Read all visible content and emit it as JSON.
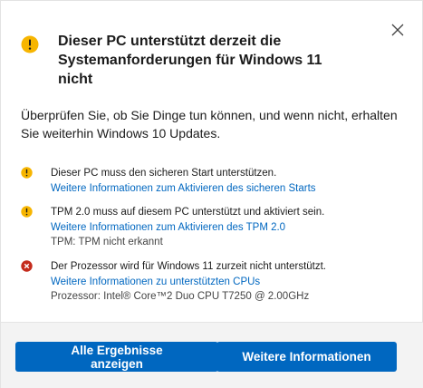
{
  "dialog": {
    "title": "Dieser PC unterstützt derzeit die Systemanforderungen für Windows 11 nicht",
    "intro": "Überprüfen Sie, ob Sie Dinge tun können, und wenn nicht, erhalten Sie weiterhin Windows 10 Updates.",
    "close_icon": "close-icon",
    "header_icon": "warning-icon",
    "colors": {
      "warning": "#f7b500",
      "error": "#c42b1c",
      "link": "#0067c0",
      "button": "#0067c0"
    }
  },
  "requirements": [
    {
      "status": "warning",
      "icon": "warning-icon",
      "title": "Dieser PC muss den sicheren Start unterstützen.",
      "link": "Weitere Informationen zum Aktivieren des sicheren Starts",
      "detail": ""
    },
    {
      "status": "warning",
      "icon": "warning-icon",
      "title": "TPM 2.0 muss auf diesem PC unterstützt und aktiviert sein.",
      "link": "Weitere Informationen zum Aktivieren des TPM 2.0",
      "detail": "TPM: TPM nicht erkannt"
    },
    {
      "status": "error",
      "icon": "error-icon",
      "title": "Der Prozessor wird für Windows 11 zurzeit nicht unterstützt.",
      "link": "Weitere Informationen zu unterstützten CPUs",
      "detail": "Prozessor: Intel® Core™2 Duo CPU T7250 @ 2.00GHz"
    }
  ],
  "footer": {
    "all_results_label": "Alle Ergebnisse anzeigen",
    "more_info_label": "Weitere Informationen"
  }
}
